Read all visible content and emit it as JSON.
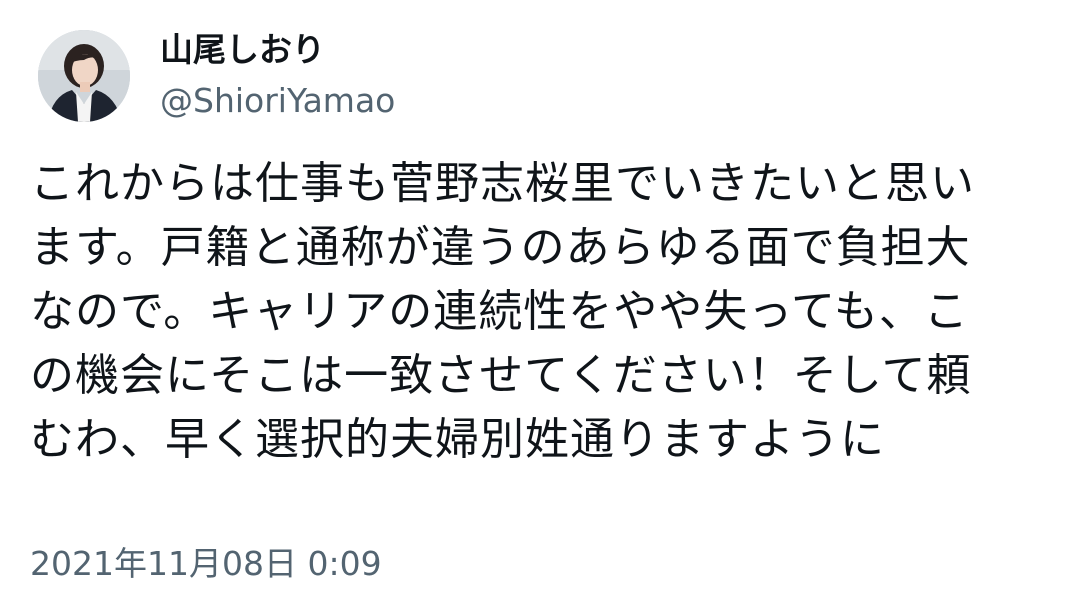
{
  "tweet": {
    "display_name": "山尾しおり",
    "handle": "@ShioriYamao",
    "body_lines": [
      "これからは仕事も菅野志桜里でいきたいと思い",
      "ます。戸籍と通称が違うのあらゆる面で負担大",
      "なので。キャリアの連続性をやや失っても、こ",
      "の機会にそこは一致させてください！そして頼",
      "むわ、早く選択的夫婦別姓通りますように"
    ],
    "timestamp": "2021年11月08日 0:09"
  },
  "colors": {
    "text_primary": "#0f1419",
    "text_secondary": "#536471",
    "background": "#ffffff"
  },
  "icons": {
    "avatar": "profile-photo-avatar"
  }
}
